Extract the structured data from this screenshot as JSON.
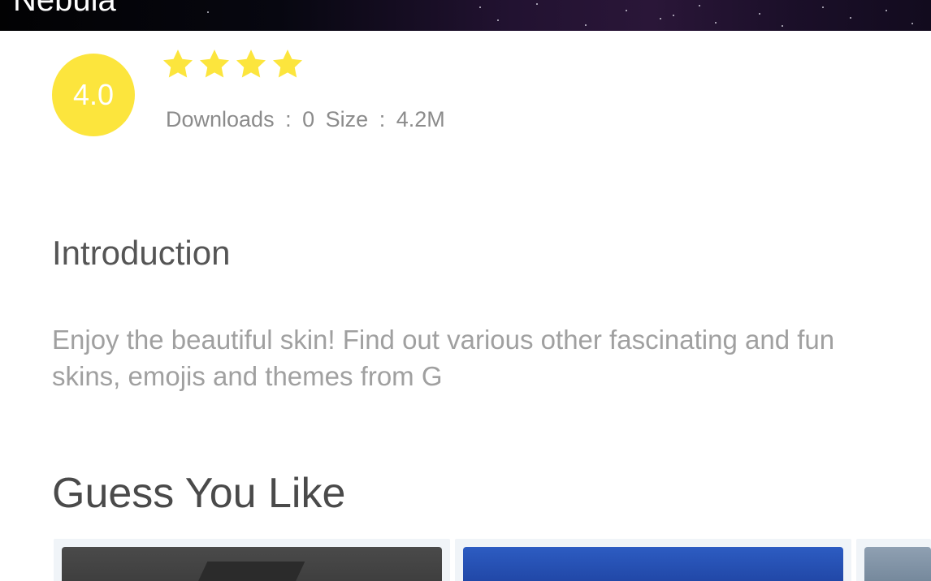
{
  "banner": {
    "title": "Nebula"
  },
  "rating": {
    "score": "4.0",
    "stars": 4,
    "star_color": "#fce53d",
    "downloads_label": "Downloads",
    "downloads_sep": ":",
    "downloads_value": "0",
    "size_label": "Size",
    "size_sep": ":",
    "size_value": "4.2M"
  },
  "introduction": {
    "title": "Introduction",
    "body": "Enjoy the beautiful skin! Find out various other fascinating and fun skins, emojis and themes from G"
  },
  "guess": {
    "title": "Guess You Like",
    "cards": [
      {
        "icon": "dark-theme-thumbnail"
      },
      {
        "icon": "blue-galaxy-theme-thumbnail"
      },
      {
        "icon": "grey-theme-thumbnail"
      }
    ]
  }
}
